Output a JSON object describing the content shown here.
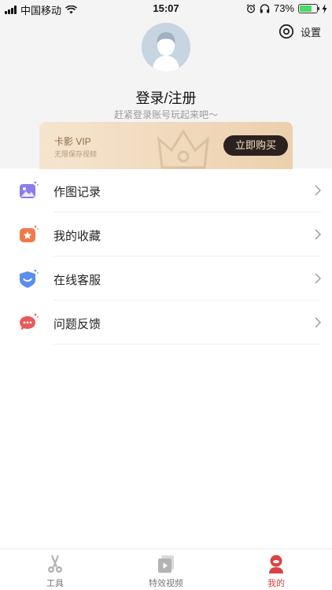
{
  "status_bar": {
    "carrier": "中国移动",
    "time": "15:07",
    "battery_percent": "73%",
    "battery_level": 0.73,
    "icons": [
      "signal-icon",
      "wifi-icon",
      "alarm-icon",
      "headphones-icon",
      "battery-icon",
      "charging-icon"
    ]
  },
  "header": {
    "settings_label": "设置",
    "login_title": "登录/注册",
    "login_subtitle": "赶紧登录账号玩起来吧～"
  },
  "vip": {
    "title": "卡影 VIP",
    "description": "无限保存视频",
    "buy_label": "立即购买"
  },
  "menu": {
    "items": [
      {
        "label": "作图记录",
        "icon": "image-record-icon",
        "color": "#8a7cf0"
      },
      {
        "label": "我的收藏",
        "icon": "favorite-star-icon",
        "color": "#f07a4a"
      },
      {
        "label": "在线客服",
        "icon": "customer-service-icon",
        "color": "#5b8ef0"
      },
      {
        "label": "问题反馈",
        "icon": "feedback-chat-icon",
        "color": "#e85a5a"
      }
    ]
  },
  "tab_bar": {
    "tabs": [
      {
        "label": "工具",
        "icon": "scissors-icon",
        "active": false
      },
      {
        "label": "特效视频",
        "icon": "video-play-icon",
        "active": false
      },
      {
        "label": "我的",
        "icon": "profile-icon",
        "active": true
      }
    ]
  },
  "colors": {
    "accent": "#d94343",
    "vip_button": "#2b221f",
    "vip_gold": "#ecd0ad"
  }
}
